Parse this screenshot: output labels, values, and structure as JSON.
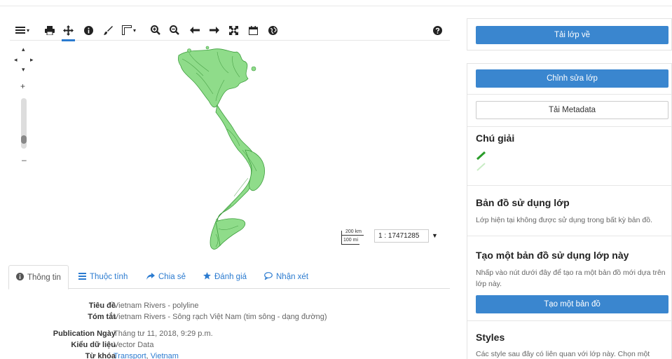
{
  "toolbar": {
    "icons": [
      "menu-icon",
      "print-icon",
      "pan-icon",
      "info-icon",
      "brush-icon",
      "measure-icon",
      "zoom-in-icon",
      "zoom-out-icon",
      "arrow-left-icon",
      "arrow-right-icon",
      "fullscreen-icon",
      "calendar-icon",
      "globe-icon",
      "help-icon"
    ],
    "active": "pan-icon"
  },
  "map": {
    "scalebar_top": "200 km",
    "scalebar_bottom": "100 mi",
    "scale_value": "1 : 17471285",
    "layer_color": "#7ed47a"
  },
  "tabs": [
    {
      "label": "Thông tin",
      "icon": "info-icon"
    },
    {
      "label": "Thuộc tính",
      "icon": "list-icon"
    },
    {
      "label": "Chia sẻ",
      "icon": "share-icon"
    },
    {
      "label": "Đánh giá",
      "icon": "star-icon"
    },
    {
      "label": "Nhận xét",
      "icon": "comment-icon"
    }
  ],
  "info": {
    "title_label": "Tiêu đề",
    "title_value": "Vietnam Rivers - polyline",
    "abstract_label": "Tóm tắt",
    "abstract_value": "Vietnam Rivers - Sông rạch Việt Nam (tim sông - dạng đường)",
    "pubdate_label": "Publication Ngày",
    "pubdate_value": "Tháng tư 11, 2018, 9:29 p.m.",
    "type_label": "Kiểu dữ liệu",
    "type_value": "Vector Data",
    "keywords_label": "Từ khóa",
    "keyword_1": "Transport",
    "keyword_sep": ",",
    "keyword_2": "Vietnam"
  },
  "sidebar": {
    "download_button": "Tải lớp về",
    "edit_button": "Chỉnh sửa lớp",
    "metadata_button": "Tải Metadata",
    "legend_title": "Chú giải",
    "maps_title": "Bản đồ sử dụng lớp",
    "maps_text": "Lớp hiện tại không được sử dụng trong bất kỳ bản đồ.",
    "create_title": "Tạo một bản đồ sử dụng lớp này",
    "create_text": "Nhấp vào nút dưới đây để tạo ra một bản đồ mới dựa trên lớp này.",
    "create_button": "Tạo một bản đồ",
    "styles_title": "Styles",
    "styles_text": "Các style sau đây có liên quan với lớp này. Chọn một"
  },
  "colors": {
    "accent": "#3a86cf",
    "link": "#2b7bd0",
    "legend_line_dark": "#2a9d2a",
    "legend_line_light": "#c8ecc4"
  }
}
